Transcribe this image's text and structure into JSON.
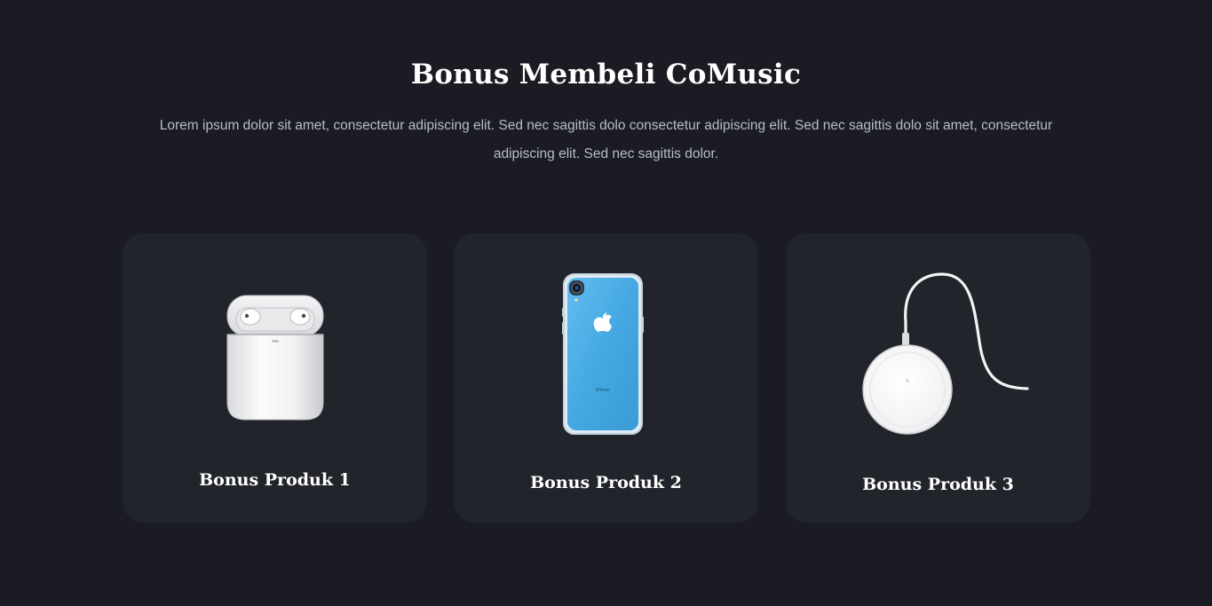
{
  "section": {
    "title": "Bonus Membeli CoMusic",
    "description": "Lorem ipsum dolor sit amet, consectetur adipiscing elit. Sed nec sagittis dolo consectetur adipiscing elit. Sed nec sagittis dolo sit amet, consectetur adipiscing elit. Sed nec sagittis dolor."
  },
  "cards": [
    {
      "title": "Bonus Produk 1",
      "image_icon": "earbuds-case-icon"
    },
    {
      "title": "Bonus Produk 2",
      "image_icon": "phone-case-icon",
      "phone_label": "iPhone"
    },
    {
      "title": "Bonus Produk 3",
      "image_icon": "wireless-charger-icon"
    }
  ],
  "colors": {
    "background": "#1b1c23",
    "card": "#22242b",
    "text": "#ffffff",
    "muted_text": "#b9bcc4",
    "phone_blue": "#45a8e2"
  }
}
